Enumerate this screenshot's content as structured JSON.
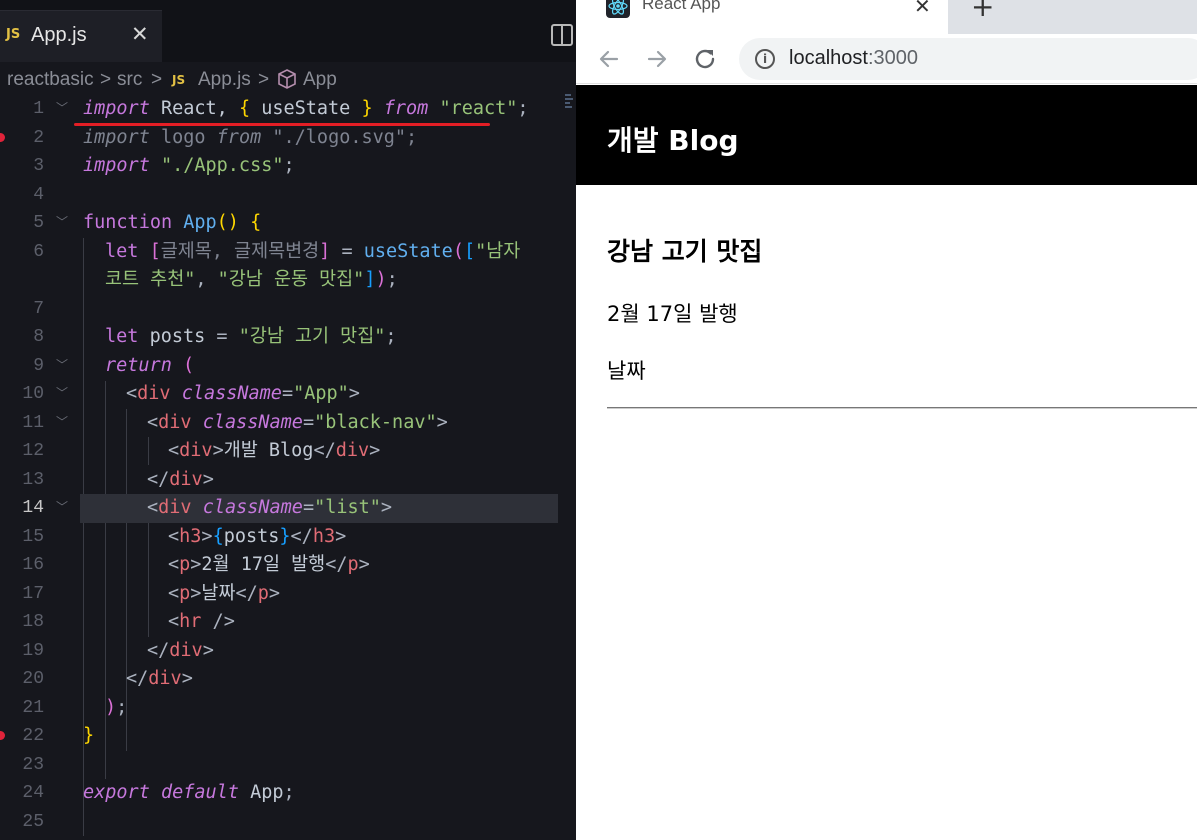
{
  "editor": {
    "tab": {
      "icon": "JS",
      "filename": "App.js",
      "close_glyph": "✕"
    },
    "breadcrumb": {
      "folder": "reactbasic",
      "sep": ">",
      "subfolder": "src",
      "file_icon": "JS",
      "file": "App.js",
      "symbol": "App"
    },
    "active_line": 14,
    "line_numbers": [
      "1",
      "2",
      "3",
      "4",
      "5",
      "6",
      "",
      "7",
      "8",
      "9",
      "10",
      "11",
      "12",
      "13",
      "14",
      "15",
      "16",
      "17",
      "18",
      "19",
      "20",
      "21",
      "22",
      "23",
      "24",
      "25"
    ],
    "code": {
      "l1": [
        "import",
        "React,",
        "{",
        "useState",
        "}",
        "from",
        "\"react\"",
        ";"
      ],
      "l2": [
        "import",
        "logo",
        "from",
        "\"./logo.svg\"",
        ";"
      ],
      "l3": [
        "import",
        "\"./App.css\"",
        ";"
      ],
      "l5": [
        "function",
        "App",
        "()",
        "{"
      ],
      "l6a": [
        "let",
        "[",
        "글제목,",
        "글제목변경",
        "]",
        "=",
        "useState",
        "(",
        "[",
        "\"남자"
      ],
      "l6b": [
        "코트 추천\"",
        ",",
        "\"강남 운동 맛집\"",
        "]",
        ")",
        ";"
      ],
      "l8": [
        "let",
        "posts",
        "=",
        "\"강남 고기 맛집\"",
        ";"
      ],
      "l9": [
        "return",
        "("
      ],
      "l10": [
        "<",
        "div",
        "className",
        "=",
        "\"App\"",
        ">"
      ],
      "l11": [
        "<",
        "div",
        "className",
        "=",
        "\"black-nav\"",
        ">"
      ],
      "l12": [
        "<",
        "div",
        ">",
        "개발 Blog",
        "</",
        "div",
        ">"
      ],
      "l13": [
        "</",
        "div",
        ">"
      ],
      "l14": [
        "<",
        "div",
        "className",
        "=",
        "\"list\"",
        ">"
      ],
      "l15": [
        "<",
        "h3",
        ">",
        "{",
        "posts",
        "}",
        "</",
        "h3",
        ">"
      ],
      "l16": [
        "<",
        "p",
        ">",
        "2월 17일 발행",
        "</",
        "p",
        ">"
      ],
      "l17": [
        "<",
        "p",
        ">",
        "날짜",
        "</",
        "p",
        ">"
      ],
      "l18": [
        "<",
        "hr",
        " />"
      ],
      "l19": [
        "</",
        "div",
        ">"
      ],
      "l20": [
        "</",
        "div",
        ">"
      ],
      "l21": [
        ")",
        ";"
      ],
      "l22": [
        "}"
      ],
      "l24": [
        "export",
        "default",
        "App",
        ";"
      ]
    },
    "accent_colors": {
      "annotation_underline": "#e41e25",
      "breakpoint": "#e0233a"
    }
  },
  "browser": {
    "tab_title": "React App",
    "tab_close": "✕",
    "new_tab": "+",
    "url_host": "localhost",
    "url_port": ":3000",
    "nav_icons": [
      "back-arrow-icon",
      "forward-arrow-icon",
      "reload-icon"
    ],
    "page": {
      "nav_title": "개발 Blog",
      "post_title": "강남 고기 맛집",
      "post_date": "2월 17일 발행",
      "post_label": "날짜"
    }
  }
}
